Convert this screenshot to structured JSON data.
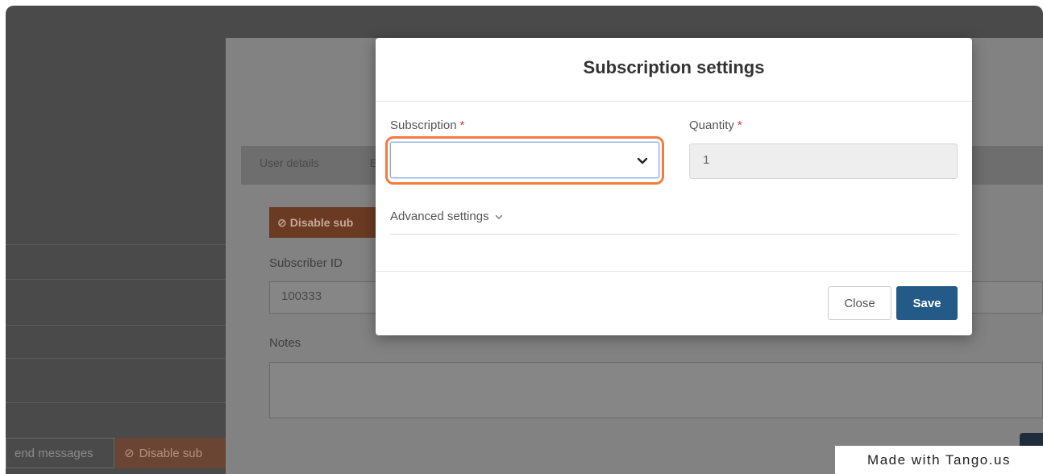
{
  "background": {
    "left_buttons": {
      "send_messages": "end messages",
      "disable": "Disable sub"
    },
    "panel": {
      "tabs": [
        "User details",
        "E"
      ],
      "disable_button": "Disable sub",
      "subscriber_id_label": "Subscriber ID",
      "subscriber_id_value": "100333",
      "notes_label": "Notes"
    }
  },
  "modal": {
    "title": "Subscription settings",
    "subscription_label": "Subscription",
    "subscription_required": "*",
    "subscription_value": "",
    "quantity_label": "Quantity",
    "quantity_required": "*",
    "quantity_value": "1",
    "advanced_label": "Advanced settings",
    "close_label": "Close",
    "save_label": "Save"
  },
  "watermark": "Made with Tango.us",
  "colors": {
    "highlight": "#f47b3c",
    "save": "#245a87",
    "required": "#e03b3b"
  },
  "icons": [
    "chevron-down-icon",
    "ban-icon"
  ]
}
